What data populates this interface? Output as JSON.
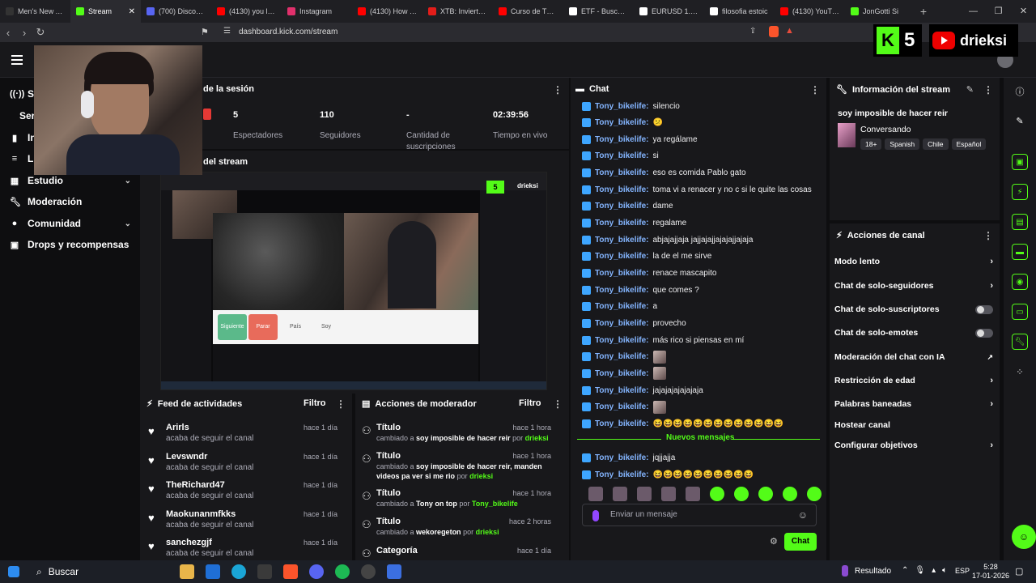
{
  "browser": {
    "tabs": [
      {
        "title": "Men's New Arr",
        "color": "#333333"
      },
      {
        "title": "Stream",
        "color": "#53fc18",
        "active": true
      },
      {
        "title": "(700) Discord |",
        "color": "#5865f2"
      },
      {
        "title": "(4130) you laug",
        "color": "#ff0000"
      },
      {
        "title": "Instagram",
        "color": "#e1306c"
      },
      {
        "title": "(4130) How To",
        "color": "#ff0000"
      },
      {
        "title": "XTB: Invierte en",
        "color": "#e31d1a"
      },
      {
        "title": "Curso de TRAD",
        "color": "#ff0000"
      },
      {
        "title": "ETF - Buscar co",
        "color": "#ffffff"
      },
      {
        "title": "EURUSD 1.159",
        "color": "#ffffff"
      },
      {
        "title": "filosofia estoic",
        "color": "#ffffff"
      },
      {
        "title": "(4130) YouTube",
        "color": "#ff0000"
      },
      {
        "title": "JonGotti Si",
        "color": "#53fc18"
      }
    ],
    "url": "dashboard.kick.com/stream"
  },
  "overlay": {
    "kick_count": "5",
    "channel": "drieksi"
  },
  "sidebar": {
    "items": [
      {
        "label": "S",
        "icon": "broadcast-icon"
      },
      {
        "label": "Ser",
        "icon": ""
      },
      {
        "label": "In",
        "icon": "chart-icon"
      },
      {
        "label": "L",
        "icon": "list-icon"
      },
      {
        "label": "Estudio",
        "icon": "grid-icon"
      },
      {
        "label": "Moderación",
        "icon": "wrench-icon"
      },
      {
        "label": "Comunidad",
        "icon": "user-icon"
      },
      {
        "label": "Drops y recompensas",
        "icon": "gift-icon"
      }
    ]
  },
  "session": {
    "title": "de la sesión",
    "stats": [
      {
        "value": "5",
        "label": "Espectadores"
      },
      {
        "value": "110",
        "label": "Seguidores"
      },
      {
        "value": "-",
        "label": "Cantidad de suscripciones"
      },
      {
        "value": "02:39:56",
        "label": "Tiempo en vivo"
      }
    ]
  },
  "preview": {
    "title": "del stream",
    "buttons": [
      "Siguiente",
      "Parar",
      "País",
      "Soy"
    ],
    "channel": "drieksi",
    "kick_count": "5"
  },
  "feed": {
    "title": "Feed de actividades",
    "filter": "Filtro",
    "rows": [
      {
        "name": "Arirls",
        "sub": "acaba de seguir el canal",
        "time": "hace 1 día"
      },
      {
        "name": "Levswndr",
        "sub": "acaba de seguir el canal",
        "time": "hace 1 día"
      },
      {
        "name": "TheRichard47",
        "sub": "acaba de seguir el canal",
        "time": "hace 1 día"
      },
      {
        "name": "Maokunanmfkks",
        "sub": "acaba de seguir el canal",
        "time": "hace 1 día"
      },
      {
        "name": "sanchezgjf",
        "sub": "acaba de seguir el canal",
        "time": "hace 1 día"
      }
    ]
  },
  "mod": {
    "title": "Acciones de moderador",
    "filter": "Filtro",
    "rows": [
      {
        "name": "Título",
        "pre": "cambiado a",
        "val": "soy imposible de hacer reir",
        "por": "por",
        "user": "drieksi",
        "time": "hace 1 hora"
      },
      {
        "name": "Título",
        "pre": "cambiado a",
        "val": "soy imposible de hacer reir, manden videos pa ver si me rio",
        "por": "por",
        "user": "drieksi",
        "time": "hace 1 hora"
      },
      {
        "name": "Título",
        "pre": "cambiado a",
        "val": "Tony on top",
        "por": "por",
        "user": "Tony_bikelife",
        "time": "hace 1 hora"
      },
      {
        "name": "Título",
        "pre": "cambiado a",
        "val": "wekoregeton",
        "por": "por",
        "user": "drieksi",
        "time": "hace 2 horas"
      },
      {
        "name": "Categoría",
        "pre": "",
        "val": "",
        "por": "",
        "user": "",
        "time": "hace 1 día"
      }
    ]
  },
  "chat": {
    "title": "Chat",
    "user": "Tony_bikelife:",
    "messages": [
      "silencio",
      "😕",
      "ya regálame",
      "si",
      "eso es comida Pablo gato",
      "toma vi a renacer y no c si le quite las cosas",
      "dame",
      "regalame",
      "abjajajjaja jajjajajjajajajjajaja",
      "la de el me sirve",
      "renace mascapito",
      "que comes ?",
      "a",
      "provecho",
      "más rico si piensas en mí",
      "",
      "",
      "jajajajajajajaja",
      "",
      "😆😆😆😆😆😆😆😆😆😆😆😆😆"
    ],
    "new_messages": "Nuevos mensajes",
    "after": [
      "jqjjajja",
      "😆😆😆😆😆😆😆😆😆😆"
    ],
    "placeholder": "Enviar un mensaje",
    "send": "Chat"
  },
  "info": {
    "title": "Información del stream",
    "stream_title": "soy imposible de hacer reir",
    "category": "Conversando",
    "tags": [
      "18+",
      "Spanish",
      "Chile",
      "Español"
    ]
  },
  "actions": {
    "title": "Acciones de canal",
    "rows": [
      {
        "label": "Modo lento",
        "kind": "arrow"
      },
      {
        "label": "Chat de solo-seguidores",
        "kind": "arrow"
      },
      {
        "label": "Chat de solo-suscriptores",
        "kind": "toggle"
      },
      {
        "label": "Chat de solo-emotes",
        "kind": "toggle"
      },
      {
        "label": "Moderación del chat con IA",
        "kind": "ext"
      },
      {
        "label": "Restricción de edad",
        "kind": "arrow"
      },
      {
        "label": "Palabras baneadas",
        "kind": "arrow"
      },
      {
        "label": "Hostear canal",
        "kind": "none"
      },
      {
        "label": "Configurar objetivos",
        "kind": "arrow"
      }
    ]
  },
  "taskbar": {
    "search": "Buscar",
    "tray_label": "Resultado",
    "lang": "ESP",
    "time": "5:28",
    "date": "17-01-2026"
  }
}
